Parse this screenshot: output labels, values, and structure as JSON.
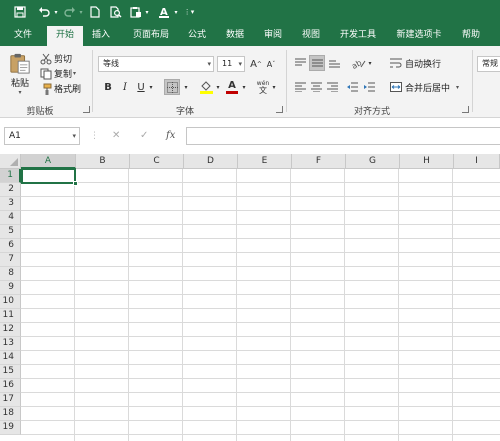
{
  "quick_access": {
    "save_icon": "save-icon",
    "undo_icon": "undo-icon",
    "redo_icon": "redo-icon",
    "new_icon": "new-file-icon",
    "preview_icon": "print-preview-icon",
    "paste_icon": "paste-icon",
    "font_color_icon": "font-color-icon"
  },
  "tabs": [
    "文件",
    "开始",
    "插入",
    "页面布局",
    "公式",
    "数据",
    "审阅",
    "视图",
    "开发工具",
    "新建选项卡",
    "帮助"
  ],
  "active_tab": "开始",
  "clipboard": {
    "paste_label": "粘贴",
    "cut_label": "剪切",
    "copy_label": "复制",
    "format_painter_label": "格式刷",
    "group_label": "剪贴板"
  },
  "font": {
    "font_name": "等线",
    "font_size": "11",
    "grow_label": "A",
    "shrink_label": "A",
    "bold": "B",
    "italic": "I",
    "underline": "U",
    "font_color_letter": "A",
    "wen_label": "wén",
    "group_label": "字体",
    "accent_color": "#217346",
    "font_color": "#c00000",
    "fill_color": "#ffff00"
  },
  "alignment": {
    "wrap_label": "自动换行",
    "merge_label": "合并后居中",
    "group_label": "对齐方式"
  },
  "number": {
    "format_value": "常规"
  },
  "formula_bar": {
    "name_box": "A1",
    "cancel": "✕",
    "enter": "✓",
    "fx": "fx",
    "content": ""
  },
  "columns": [
    "A",
    "B",
    "C",
    "D",
    "E",
    "F",
    "G",
    "H",
    "I"
  ],
  "rows": [
    "1",
    "2",
    "3",
    "4",
    "5",
    "6",
    "7",
    "8",
    "9",
    "10",
    "11",
    "12",
    "13",
    "14",
    "15",
    "16",
    "17",
    "18",
    "19"
  ],
  "active_cell": "A1"
}
